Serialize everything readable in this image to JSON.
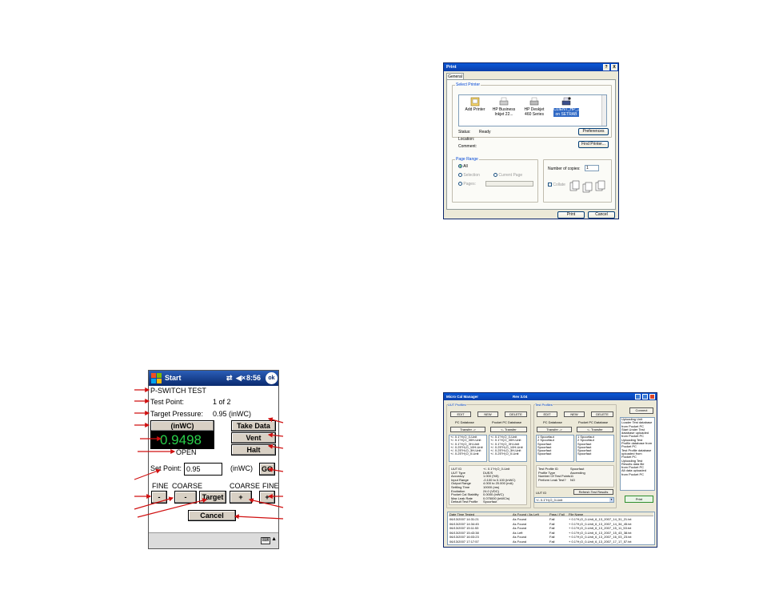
{
  "print_dialog": {
    "title": "Print",
    "help_btn": "?",
    "close_btn": "X",
    "tab": "General",
    "select_printer_label": "Select Printer",
    "printers": [
      {
        "name": "Add Printer",
        "icon": "add-printer-icon"
      },
      {
        "name": "HP Business Inkjet 22...",
        "icon": "printer-icon"
      },
      {
        "name": "HP Deskjet 460 Series",
        "icon": "printer-icon"
      },
      {
        "name": "CLIENT_HP_JNPLUS on SETRAB",
        "icon": "network-printer-icon",
        "selected": true
      }
    ],
    "status_label": "Status:",
    "status_value": "Ready",
    "location_label": "Location:",
    "comment_label": "Comment:",
    "preferences_btn": "Preferences",
    "find_printer_btn": "Find Printer...",
    "page_range_label": "Page Range",
    "all_label": "All",
    "selection_label": "Selection",
    "current_page_label": "Current Page",
    "pages_label": "Pages:",
    "copies_label": "Number of copies:",
    "copies_value": "1",
    "collate_label": "Collate",
    "print_btn": "Print",
    "cancel_btn": "Cancel"
  },
  "pocket_pc": {
    "start_label": "Start",
    "time": "8:56",
    "ok_label": "ok",
    "title": "P-SWITCH TEST",
    "test_point_label": "Test Point:",
    "test_point_value": "1 of 2",
    "target_pressure_label": "Target Pressure:",
    "target_pressure_value": "0.95 (inWC)",
    "unit_btn": "(inWC)",
    "reading": "0.9498",
    "switch_state": "OPEN",
    "take_data_btn": "Take Data",
    "vent_btn": "Vent",
    "halt_btn": "Halt",
    "set_point_label": "Set Point:",
    "set_point_value": "0.95",
    "set_point_unit": "(inWC)",
    "go_btn": "GO",
    "fine_left": "FINE",
    "coarse_left": "COARSE",
    "coarse_right": "COARSE",
    "fine_right": "FINE",
    "minus": "-",
    "plus": "+",
    "target_btn": "Target",
    "cancel_btn": "Cancel"
  },
  "mcm": {
    "title": "Micro Cal Manager",
    "version": "Rev 3.04",
    "uut_profiles_label": "UUT Profiles",
    "test_profiles_label": "Test Profiles",
    "edit_btn": "EDIT",
    "new_btn": "NEW",
    "delete_btn": "DELETE",
    "pc_database_label": "PC Database",
    "pocket_pc_database_label": "Pocket PC Database",
    "transfer_right_btn": "Transfer ->",
    "transfer_left_btn": "<- Transfer",
    "uut_pc_list": [
      "+/- 0.1\"H₂O_0-Unit",
      "+/- 0.1\"H₂O_30H-Unit",
      "+/- 0.1\"H₂O_3H-Unit",
      "+/- 0.25\"H₂O_10H-Unit",
      "+/- 0.25\"H₂O_3H-Unit",
      "+/- 0.25\"H₂O_0-Unit"
    ],
    "uut_ppc_list": [
      "+/- 0.1\"H₂O_0-Unit",
      "+/- 0.1\"H₂O_30H-Unit",
      "+/- 0.1\"H₂O_3H-Unit",
      "+/- 0.25\"H₂O_10H-Unit",
      "+/- 0.25\"H₂O_3H-Unit",
      "+/- 0.25\"H₂O_0-Unit"
    ],
    "test_pc_list": [
      "1 Spoorfaut",
      "2 Spoorfaut",
      "Spoorfaut",
      "Spoorfaut",
      "Spoorfaut",
      "Spoorfaut"
    ],
    "test_ppc_list": [
      "1 Spoorfaut",
      "2 Spoorfaut",
      "Spoorfaut",
      "Spoorfaut",
      "Spoorfaut",
      "Spoorfaut"
    ],
    "uut_details": [
      {
        "k": "UUT ID",
        "v": "+/- 0.1\"H₂O_0-Unit"
      },
      {
        "k": "UUT Type",
        "v": "DUE/S"
      },
      {
        "k": "Accuracy",
        "v": "1.000 (%5)"
      },
      {
        "k": "Input Range",
        "v": "-0.100 to 0.100 (inWC)"
      },
      {
        "k": "Output Range",
        "v": "4.000 to 20.000 (mA)"
      },
      {
        "k": "Settling Time",
        "v": "10000 (ms)"
      },
      {
        "k": "Excitation",
        "v": "24.0 (VDC)"
      },
      {
        "k": "Pocket Cal Stability",
        "v": "0.0000 (inWC)"
      },
      {
        "k": "Max Leak Rate",
        "v": "0.075000 (inWC/s)"
      },
      {
        "k": "Default Test Profile",
        "v": "Spoorfaut"
      }
    ],
    "test_details": [
      {
        "k": "Test Profile ID",
        "v": "Spoorfaut"
      },
      {
        "k": "Profile Type",
        "v": "Ascending"
      },
      {
        "k": "Number Of Test Points",
        "v": "11"
      },
      {
        "k": "Perform Leak Test?",
        "v": "NO"
      }
    ],
    "uut_id_label": "UUT ID",
    "refresh_btn": "Refresh Test Results",
    "uut_id_select": "+/- 0.1\"H₂O_0-Unit",
    "connect_btn": "Connect",
    "log_lines": [
      "Uploading Unit",
      "Loader Test database",
      "from Pocket PC",
      "Start Under Test",
      "database uploaded",
      "from Pocket PC",
      "Uploading Test",
      "Profile database from",
      "Pocket PC",
      "Test Profile database",
      "uploaded from",
      "Pocket PC",
      "Uploading Test",
      "Results data file",
      "from Pocket PC",
      "All data uploaded",
      "from Pocket PC"
    ],
    "print_btn": "Print",
    "table_headers": [
      "Date Time Tested",
      "As Found / As Left",
      "Pass / Fail",
      "File Name"
    ],
    "table_rows": [
      [
        "06/13/2007 14:31:21",
        "As Found",
        "Fail",
        "+ 0.1\"H₂O_0-Unit_6_13_2007_14_31_21.txt"
      ],
      [
        "06/13/2007 14:34:45",
        "As Found",
        "Fail",
        "+ 0.1\"H₂O_0-Unit_6_13_2007_14_34_45.txt"
      ],
      [
        "06/13/2007 15:11:53",
        "As Found",
        "Fail",
        "+ 0.1\"H₂O_0-Unit_6_13_2007_15_11_53.txt"
      ],
      [
        "06/13/2007 15:43:38",
        "As Left",
        "Fail",
        "+ 0.1\"H₂O_0-Unit_6_13_2007_15_43_38.txt"
      ],
      [
        "06/13/2007 16:03:23",
        "As Found",
        "Fail",
        "+ 0.1\"H₂O_0-Unit_6_13_2007_16_03_23.txt"
      ],
      [
        "06/13/2007 17:17:57",
        "As Found",
        "Fail",
        "+ 0.1\"H₂O_0-Unit_6_13_2007_17_17_57.txt"
      ]
    ]
  }
}
